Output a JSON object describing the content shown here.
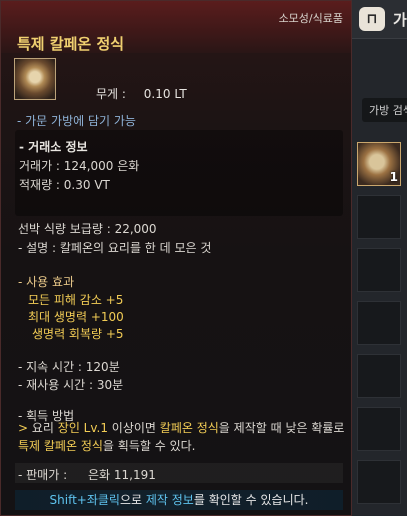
{
  "inventory": {
    "title_fragment": "가",
    "search_label": "가방 검색",
    "slot_count": "1"
  },
  "tooltip": {
    "category": "소모성/식료품",
    "item_name": "특제 칼페온 정식",
    "weight_label": "무게 :",
    "weight_value": "0.10 LT",
    "bag_note": "- 가문 가방에 담기 가능",
    "market": {
      "header": "- 거래소 정보",
      "price": "거래가 : 124,000 은화",
      "load": "적재량 : 0.30 VT"
    },
    "ship_food": "선박 식량 보급량 : 22,000",
    "description": "- 설명 : 칼페온의 요리를 한 데 모은 것",
    "effects_header": "- 사용 효과",
    "effects": [
      "모든 피해 감소 +5",
      "최대 생명력 +100",
      "생명력 회복량 +5"
    ],
    "duration": "- 지속 시간 : 120분",
    "cooldown": "- 재사용 시간 : 30분",
    "obtain_header": "- 획득 방법",
    "obtain": {
      "arrow": ">",
      "p1": " 요리 ",
      "skill": "장인 Lv.1",
      "p2": " 이상이면 ",
      "item": "칼페온 정식",
      "p3": "을 제작할 때 낮은 확률로 ",
      "item2": "특제 칼페온 정식",
      "p4": "을 획득할 수 있다."
    },
    "sell_label": "- 판매가 :",
    "sell_value": "은화 11,191",
    "hint": {
      "key": "Shift+좌클릭",
      "p1": "으로 ",
      "target": "제작 정보",
      "p2": "를 확인할 수 있습니다."
    }
  }
}
